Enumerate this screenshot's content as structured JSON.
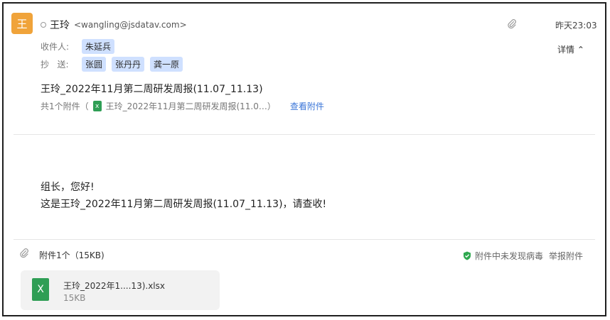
{
  "sender": {
    "avatar_char": "王",
    "name": "王玲",
    "email": "<wangling@jsdatav.com>"
  },
  "recipients": {
    "to_label": "收件人:",
    "to": [
      "朱延兵"
    ],
    "cc_label": "抄   送:",
    "cc": [
      "张圆",
      "张丹丹",
      "龚一原"
    ]
  },
  "meta": {
    "time": "昨天23:03",
    "details_label": "详情 ⌃"
  },
  "subject": "王玲_2022年11月第二周研发周报(11.07_11.13)",
  "attachment_summary": {
    "prefix": "共1个附件（",
    "file": "王玲_2022年11月第二周研发周报(11.0…",
    "suffix": "）",
    "view_link": "查看附件"
  },
  "body": {
    "line1": "组长，您好!",
    "line2": "这是王玲_2022年11月第二周研发周报(11.07_11.13)，请查收!"
  },
  "footer": {
    "count": "附件1个（15KB)",
    "virus_status": "附件中未发现病毒",
    "report": "举报附件"
  },
  "attachment": {
    "name": "王玲_2022年1....13).xlsx",
    "size": "15KB",
    "icon_char": "X",
    "icon_color": "#2f9e55"
  }
}
